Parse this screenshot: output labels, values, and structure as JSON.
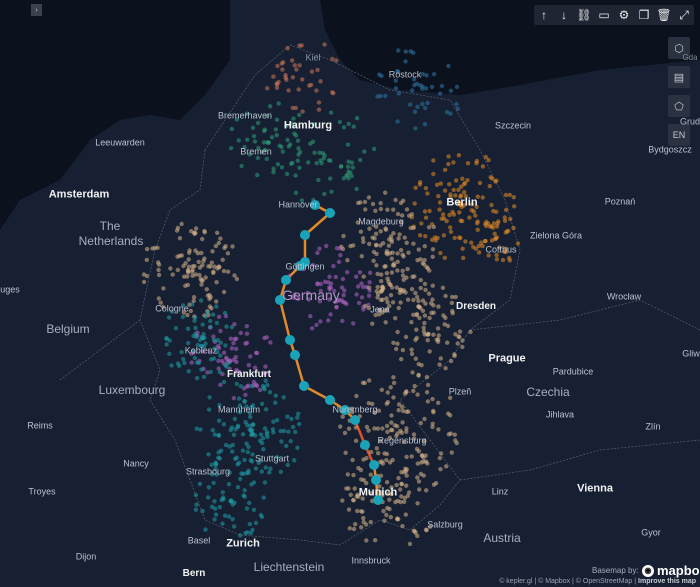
{
  "toolbar": [
    {
      "name": "arrow-up-icon",
      "glyph": "↑"
    },
    {
      "name": "arrow-down-icon",
      "glyph": "↓"
    },
    {
      "name": "link-icon",
      "glyph": "⛓"
    },
    {
      "name": "comment-icon",
      "glyph": "▭"
    },
    {
      "name": "gear-icon",
      "glyph": "⚙"
    },
    {
      "name": "copy-icon",
      "glyph": "❐"
    },
    {
      "name": "trash-icon",
      "glyph": "🗑"
    },
    {
      "name": "expand-icon",
      "glyph": "⤢"
    }
  ],
  "side_controls": {
    "cube_icon": "cube-icon",
    "legend_icon": "layers-legend-icon",
    "draw_icon": "polygon-draw-icon",
    "lang": "EN"
  },
  "collapse_icon": "chevron-right-icon",
  "collapse_glyph": "›",
  "labels": {
    "kiel": "Kiel",
    "rostock": "Rostock",
    "gda": "Gda",
    "hamburg": "Hamburg",
    "bremerhaven": "Bremerhaven",
    "szczecin": "Szczecin",
    "leeuwarden": "Leeuwarden",
    "bremen": "Bremen",
    "bydgoszcz": "Bydgoszcz",
    "amsterdam": "Amsterdam",
    "the": "The",
    "netherlands": "Netherlands",
    "hannover": "Hannover",
    "magdeburg": "Magdeburg",
    "berlin": "Berlin",
    "poznan": "Poznań",
    "zielona": "Zielona Góra",
    "cottbus": "Cottbus",
    "gottingen": "Göttingen",
    "germany": "Germany",
    "ugues": "uges",
    "cologne": "Cologne",
    "jena": "Jena",
    "dresden": "Dresden",
    "wroclaw": "Wrocław",
    "belgium": "Belgium",
    "koblenz": "Koblenz",
    "prague": "Prague",
    "gliw": "Gliw",
    "luxembourg": "Luxembourg",
    "frankfurt": "Frankfurt",
    "pardubice": "Pardubice",
    "plzen": "Plzeň",
    "czechia": "Czechia",
    "mannheim": "Mannheim",
    "nuremberg": "Nuremberg",
    "jihlava": "Jihlava",
    "reims": "Reims",
    "regensburg": "Regensburg",
    "zlin": "Zlín",
    "nancy": "Nancy",
    "stuttgart": "Stuttgart",
    "strasbourg": "Strasbourg",
    "troyes": "Troyes",
    "munich": "Munich",
    "vienna": "Vienna",
    "linz": "Linz",
    "salzburg": "Salzburg",
    "austria": "Austria",
    "gyor": "Gyor",
    "basel": "Basel",
    "zurich": "Zurich",
    "dijon": "Dijon",
    "liechtenstein": "Liechtenstein",
    "innsbruck": "Innsbruck",
    "bern": "Bern",
    "grud": "Grud"
  },
  "basemap_by": "Basemap by:",
  "mapbox": "mapbo",
  "attribution": {
    "text": "© kepler.gl | © Mapbox | © OpenStreetMap | ",
    "improve": "Improve this map"
  },
  "colors": {
    "background": "#0d1422",
    "land": "#172133",
    "route_dot": "#1aa3b8",
    "route_line_warm": "#e08a2a",
    "route_line_hot": "#d9532b",
    "cluster_orange": "#e58c24",
    "cluster_beige": "#d8b48a",
    "cluster_teal": "#1f9ea6",
    "cluster_purple": "#b565c8",
    "cluster_green": "#2f9e78",
    "cluster_salmon": "#d2785a",
    "cluster_blue": "#2f77a8"
  }
}
